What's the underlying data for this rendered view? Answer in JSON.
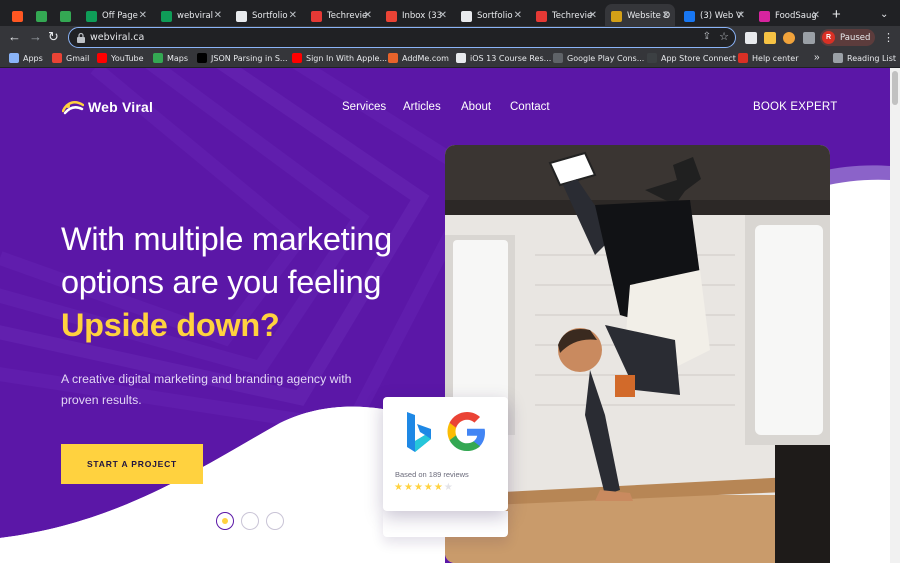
{
  "browser": {
    "tabs": [
      {
        "title": "",
        "icon": "flame-icon"
      },
      {
        "title": "",
        "icon": "google-drive-icon"
      },
      {
        "title": "",
        "icon": "google-drive-icon"
      },
      {
        "title": "Off Page",
        "icon": "google-sheets-icon"
      },
      {
        "title": "webviral",
        "icon": "google-sheets-icon"
      },
      {
        "title": "Sortfolio",
        "icon": "grid-icon"
      },
      {
        "title": "Techrevie",
        "icon": "star-icon"
      },
      {
        "title": "Inbox (33",
        "icon": "gmail-icon"
      },
      {
        "title": "Sortfolio",
        "icon": "grid-icon"
      },
      {
        "title": "Techrevie",
        "icon": "star-icon"
      },
      {
        "title": "Website D",
        "icon": "site-icon",
        "active": true
      },
      {
        "title": "(3) Web V",
        "icon": "facebook-icon"
      },
      {
        "title": "FoodSaug",
        "icon": "instagram-icon"
      }
    ],
    "url": "webviral.ca",
    "profile_initial": "R",
    "profile_status": "Paused",
    "bookmarks": [
      {
        "label": "Apps",
        "icon": "apps-icon"
      },
      {
        "label": "Gmail",
        "icon": "gmail-icon"
      },
      {
        "label": "YouTube",
        "icon": "youtube-icon"
      },
      {
        "label": "Maps",
        "icon": "maps-icon"
      },
      {
        "label": "JSON Parsing in S...",
        "icon": "medium-icon"
      },
      {
        "label": "Sign In With Apple...",
        "icon": "youtube-icon"
      },
      {
        "label": "AddMe.com",
        "icon": "addme-icon"
      },
      {
        "label": "iOS 13 Course Res...",
        "icon": "github-icon"
      },
      {
        "label": "Google Play Cons...",
        "icon": "play-console-icon"
      },
      {
        "label": "App Store Connect",
        "icon": "app-store-icon"
      },
      {
        "label": "Help center",
        "icon": "help-icon"
      },
      {
        "label": "Reading List",
        "icon": "reading-list-icon"
      }
    ]
  },
  "site": {
    "logo_text": "Web Viral",
    "nav": [
      "Services",
      "Articles",
      "About",
      "Contact"
    ],
    "book_label": "BOOK EXPERT",
    "headline_line1": "With multiple marketing",
    "headline_line2": "options are you feeling",
    "headline_highlight": "Upside down?",
    "subtitle": "A creative digital marketing and branding agency with proven results.",
    "cta_label": "START A PROJECT",
    "reviews_text": "Based on 189 reviews",
    "rating": 5,
    "rating_out_of": 6,
    "slider_count": 3,
    "slider_active": 1
  },
  "colors": {
    "brand_purple": "#5b17a7",
    "accent_yellow": "#ffd23f"
  }
}
